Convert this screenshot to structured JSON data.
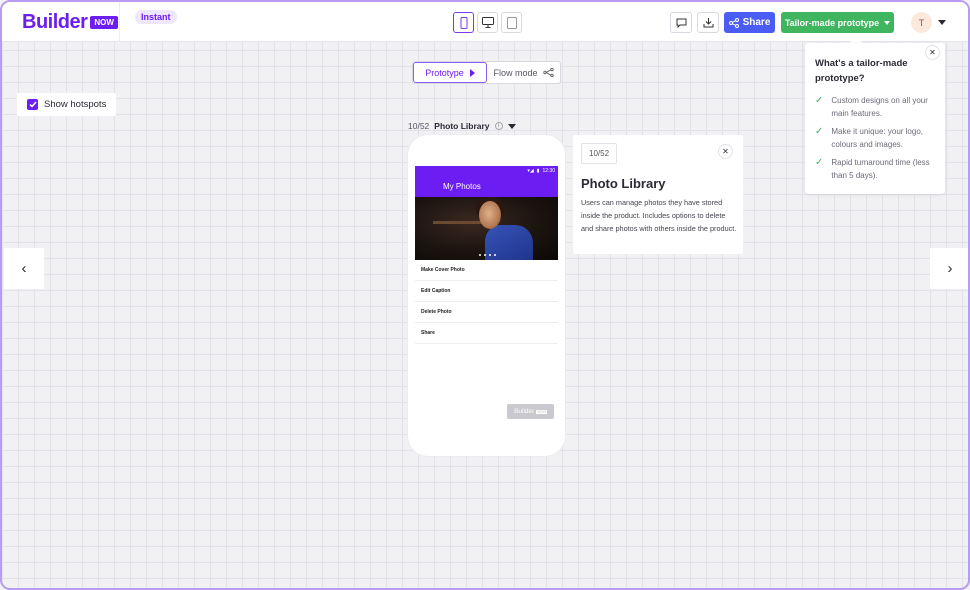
{
  "header": {
    "logo_text": "Builder",
    "logo_badge": "NOW",
    "instant_badge": "Instant",
    "share_label": "Share",
    "tailor_label": "Tailor-made prototype",
    "avatar_initial": "T"
  },
  "mode_toggle": {
    "prototype_label": "Prototype",
    "flow_label": "Flow mode"
  },
  "hotspots": {
    "label": "Show hotspots",
    "checked": true
  },
  "screen": {
    "count": "10/52",
    "name": "Photo Library",
    "phone": {
      "status_time": "12:30",
      "app_title": "My Photos",
      "menu_items": [
        "Make Cover Photo",
        "Edit Caption",
        "Delete Photo",
        "Share"
      ],
      "watermark_text": "Builder",
      "watermark_badge": "NOW"
    }
  },
  "detail": {
    "count": "10/52",
    "title": "Photo Library",
    "description": "Users can manage photos they have stored inside the product. Includes options to delete and share photos with others inside the product."
  },
  "popover": {
    "title": "What's a tailor-made prototype?",
    "items": [
      "Custom designs on all your main features.",
      "Make it unique: your logo, colours and images.",
      "Rapid turnaround time (less than 5 days)."
    ]
  },
  "colors": {
    "brand": "#6c1df2",
    "share": "#4a5cf2",
    "tailor": "#3eb55e",
    "border": "#b99bf2"
  }
}
